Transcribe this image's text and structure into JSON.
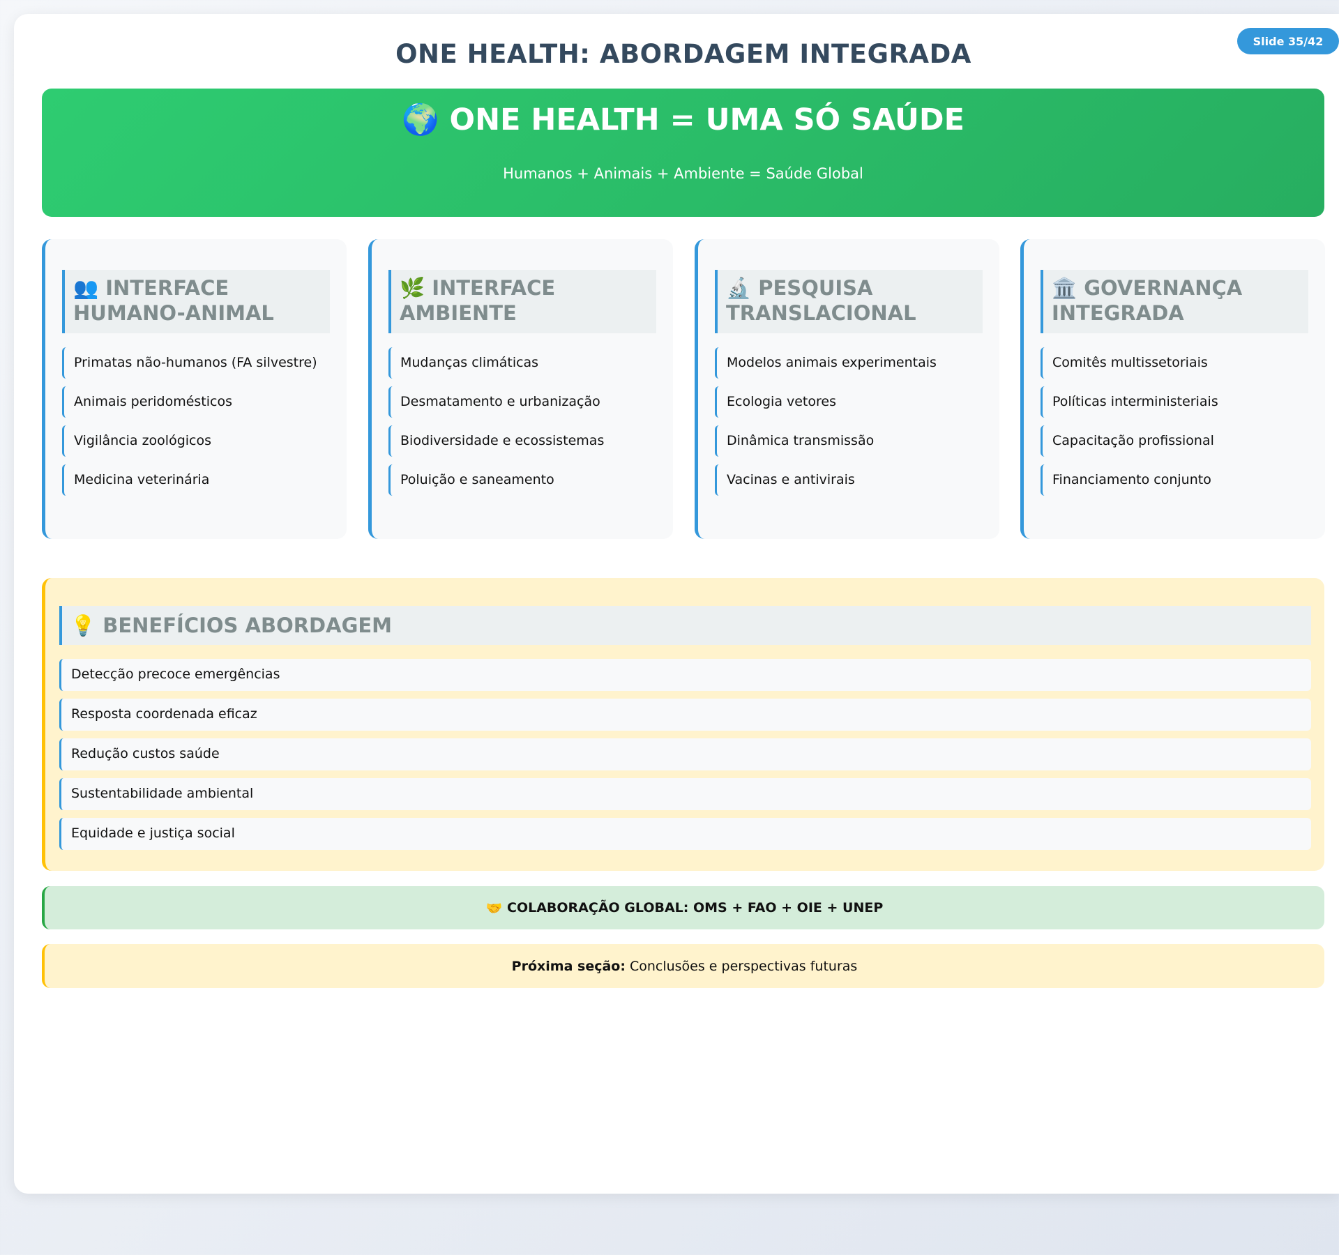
{
  "slide_badge": "Slide 35/42",
  "title": "ONE HEALTH: ABORDAGEM INTEGRADA",
  "banner": {
    "icon": "🌍",
    "heading": "ONE HEALTH = UMA SÓ SAÚDE",
    "subtitle": "Humanos + Animais + Ambiente = Saúde Global"
  },
  "cards": [
    {
      "icon": "👥",
      "title": "INTERFACE HUMANO-ANIMAL",
      "items": [
        "Primatas não-humanos (FA silvestre)",
        "Animais peridomésticos",
        "Vigilância zoológicos",
        "Medicina veterinária"
      ]
    },
    {
      "icon": "🌿",
      "title": "INTERFACE AMBIENTE",
      "items": [
        "Mudanças climáticas",
        "Desmatamento e urbanização",
        "Biodiversidade e ecossistemas",
        "Poluição e saneamento"
      ]
    },
    {
      "icon": "🔬",
      "title": "PESQUISA TRANSLACIONAL",
      "items": [
        "Modelos animais experimentais",
        "Ecologia vetores",
        "Dinâmica transmissão",
        "Vacinas e antivirais"
      ]
    },
    {
      "icon": "🏛️",
      "title": "GOVERNANÇA INTEGRADA",
      "items": [
        "Comitês multissetoriais",
        "Políticas interministeriais",
        "Capacitação profissional",
        "Financiamento conjunto"
      ]
    }
  ],
  "benefits": {
    "icon": "💡",
    "title": "BENEFÍCIOS ABORDAGEM",
    "items": [
      "Detecção precoce emergências",
      "Resposta coordenada eficaz",
      "Redução custos saúde",
      "Sustentabilidade ambiental",
      "Equidade e justiça social"
    ]
  },
  "collaboration": {
    "icon": "🤝",
    "text": "COLABORAÇÃO GLOBAL: OMS + FAO + OIE + UNEP"
  },
  "next_section": {
    "label": "Próxima seção:",
    "text": "Conclusões e perspectivas futuras"
  }
}
